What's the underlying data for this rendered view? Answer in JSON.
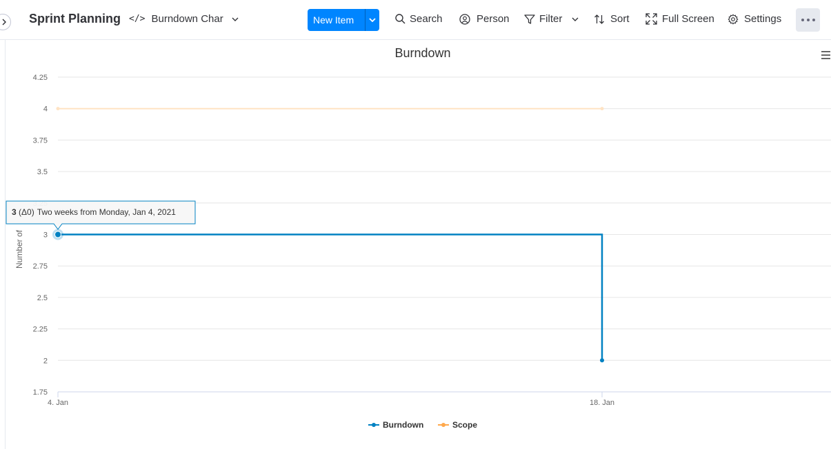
{
  "toolbar": {
    "board_title": "Sprint Planning",
    "view_name": "Burndown Char",
    "new_item": "New Item",
    "search": "Search",
    "person": "Person",
    "filter": "Filter",
    "sort": "Sort",
    "full_screen": "Full Screen",
    "settings": "Settings"
  },
  "colors": {
    "accent": "#0085ff",
    "burndown": "#0081c2",
    "scope": "#ffa84b"
  },
  "chart_data": {
    "type": "line",
    "title": "Burndown",
    "ylabel": "Number of",
    "x": [
      "2021-01-04",
      "2021-01-18"
    ],
    "x_tick_labels": [
      "4. Jan",
      "18. Jan"
    ],
    "ylim": [
      1.75,
      4.25
    ],
    "y_ticks": [
      "4.25",
      "4",
      "3.75",
      "3.5",
      "3.25",
      "3",
      "2.75",
      "2.5",
      "2.25",
      "2",
      "1.75"
    ],
    "grid": true,
    "legend_placement": "bottom",
    "series": [
      {
        "name": "Burndown",
        "step": true,
        "values": [
          3,
          2
        ]
      },
      {
        "name": "Scope",
        "values": [
          4,
          4
        ]
      }
    ],
    "tooltip": {
      "value": "3",
      "delta": "(Δ0)",
      "text": "Two weeks from Monday, Jan 4, 2021"
    }
  }
}
